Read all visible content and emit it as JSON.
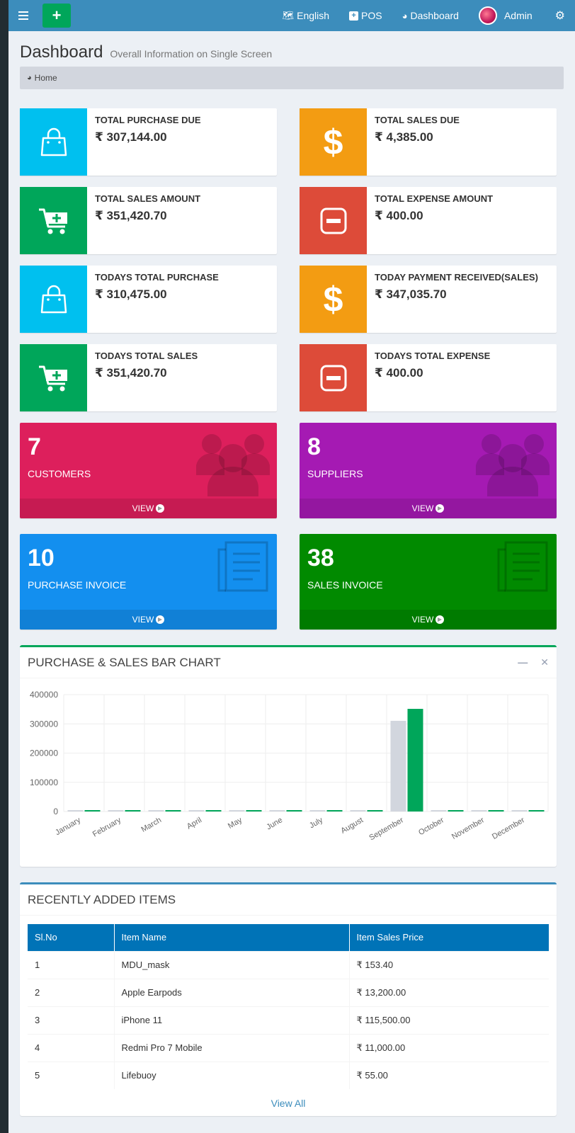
{
  "navbar": {
    "language": "English",
    "pos": "POS",
    "dashboard": "Dashboard",
    "user": "Admin"
  },
  "header": {
    "title": "Dashboard",
    "subtitle": "Overall Information on Single Screen",
    "breadcrumb": "Home"
  },
  "info_boxes": [
    {
      "label": "TOTAL PURCHASE DUE",
      "value": "₹ 307,144.00",
      "icon": "shopping-bag-icon",
      "color": "#00c0ef"
    },
    {
      "label": "TOTAL SALES DUE",
      "value": "₹ 4,385.00",
      "icon": "dollar-icon",
      "color": "#f39c12"
    },
    {
      "label": "TOTAL SALES AMOUNT",
      "value": "₹ 351,420.70",
      "icon": "cart-plus-icon",
      "color": "#00a65a"
    },
    {
      "label": "TOTAL EXPENSE AMOUNT",
      "value": "₹ 400.00",
      "icon": "minus-square-icon",
      "color": "#dd4b39"
    },
    {
      "label": "TODAYS TOTAL PURCHASE",
      "value": "₹ 310,475.00",
      "icon": "shopping-bag-icon",
      "color": "#00c0ef"
    },
    {
      "label": "TODAY PAYMENT RECEIVED(SALES)",
      "value": "₹ 347,035.70",
      "icon": "dollar-icon",
      "color": "#f39c12"
    },
    {
      "label": "TODAYS TOTAL SALES",
      "value": "₹ 351,420.70",
      "icon": "cart-plus-icon",
      "color": "#00a65a"
    },
    {
      "label": "TODAYS TOTAL EXPENSE",
      "value": "₹ 400.00",
      "icon": "minus-square-icon",
      "color": "#dd4b39"
    }
  ],
  "small_boxes": [
    {
      "count": "7",
      "label": "CUSTOMERS",
      "footer": "VIEW",
      "icon": "users-icon",
      "color": "#dd1f5c"
    },
    {
      "count": "8",
      "label": "SUPPLIERS",
      "footer": "VIEW",
      "icon": "users-icon",
      "color": "#a51ab3"
    },
    {
      "count": "10",
      "label": "PURCHASE INVOICE",
      "footer": "VIEW",
      "icon": "invoice-icon",
      "color": "#138fef"
    },
    {
      "count": "38",
      "label": "SALES INVOICE",
      "footer": "VIEW",
      "icon": "invoice-icon",
      "color": "#018a00"
    }
  ],
  "chart_box": {
    "title": "PURCHASE & SALES BAR CHART"
  },
  "chart_data": {
    "type": "bar",
    "categories": [
      "January",
      "February",
      "March",
      "April",
      "May",
      "June",
      "July",
      "August",
      "September",
      "October",
      "November",
      "December"
    ],
    "series": [
      {
        "color": "#d2d6de",
        "values": [
          0,
          0,
          0,
          0,
          0,
          0,
          0,
          0,
          310475,
          0,
          0,
          0
        ]
      },
      {
        "color": "#00a65a",
        "values": [
          0,
          0,
          0,
          0,
          0,
          0,
          0,
          0,
          351420.7,
          0,
          0,
          0
        ]
      }
    ],
    "yticks": [
      "400000",
      "300000",
      "200000",
      "100000",
      "0"
    ],
    "ylim": [
      0,
      400000
    ],
    "grid": true
  },
  "recent_items": {
    "title": "RECENTLY ADDED ITEMS",
    "columns": [
      "Sl.No",
      "Item Name",
      "Item Sales Price"
    ],
    "rows": [
      [
        "1",
        "MDU_mask",
        "₹ 153.40"
      ],
      [
        "2",
        "Apple Earpods",
        "₹ 13,200.00"
      ],
      [
        "3",
        "iPhone 11",
        "₹ 115,500.00"
      ],
      [
        "4",
        "Redmi Pro 7 Mobile",
        "₹ 11,000.00"
      ],
      [
        "5",
        "Lifebuoy",
        "₹ 55.00"
      ]
    ],
    "view_all": "View All"
  }
}
